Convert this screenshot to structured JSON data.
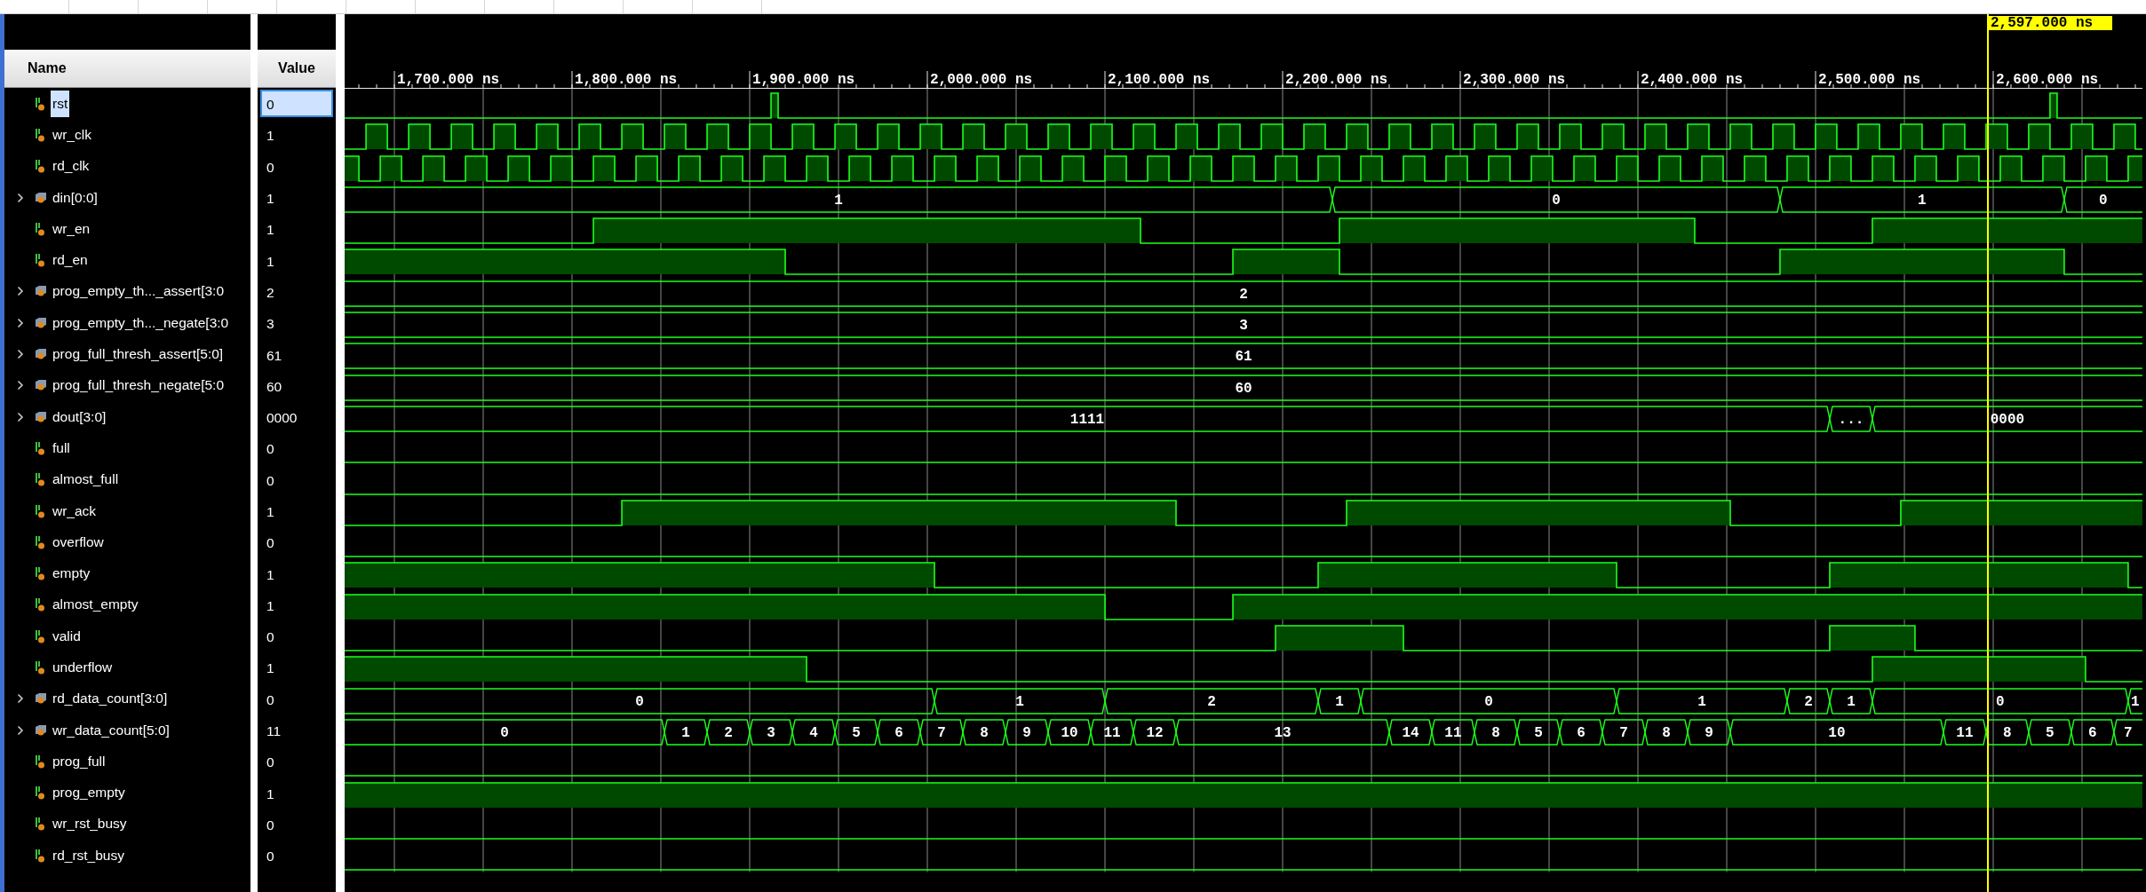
{
  "columns": {
    "name": "Name",
    "value": "Value"
  },
  "timeline": {
    "ticks": [
      "1,700.000 ns",
      "1,800.000 ns",
      "1,900.000 ns",
      "2,000.000 ns",
      "2,100.000 ns",
      "2,200.000 ns",
      "2,300.000 ns",
      "2,400.000 ns",
      "2,500.000 ns",
      "2,600.000 ns"
    ],
    "cursor": {
      "label": "2,597.000 ns",
      "level": 0.914
    }
  },
  "signals": [
    {
      "name": "rst",
      "value": "0",
      "kind": "bit",
      "selected": true
    },
    {
      "name": "wr_clk",
      "value": "1",
      "kind": "bit",
      "selected": false
    },
    {
      "name": "rd_clk",
      "value": "0",
      "kind": "bit",
      "selected": false
    },
    {
      "name": "din[0:0]",
      "value": "1",
      "kind": "bus",
      "selected": false,
      "data": [
        "1",
        "0",
        "1",
        "0"
      ]
    },
    {
      "name": "wr_en",
      "value": "1",
      "kind": "bit",
      "selected": false
    },
    {
      "name": "rd_en",
      "value": "1",
      "kind": "bit",
      "selected": false
    },
    {
      "name": "prog_empty_th..._assert[3:0",
      "value": "2",
      "kind": "bus",
      "selected": false,
      "data": [
        "2"
      ]
    },
    {
      "name": "prog_empty_th..._negate[3:0",
      "value": "3",
      "kind": "bus",
      "selected": false,
      "data": [
        "3"
      ]
    },
    {
      "name": "prog_full_thresh_assert[5:0]",
      "value": "61",
      "kind": "bus",
      "selected": false,
      "data": [
        "61"
      ]
    },
    {
      "name": "prog_full_thresh_negate[5:0",
      "value": "60",
      "kind": "bus",
      "selected": false,
      "data": [
        "60"
      ]
    },
    {
      "name": "dout[3:0]",
      "value": "0000",
      "kind": "bus",
      "selected": false,
      "data": [
        "1111",
        "...",
        "0000"
      ]
    },
    {
      "name": "full",
      "value": "0",
      "kind": "bit",
      "selected": false
    },
    {
      "name": "almost_full",
      "value": "0",
      "kind": "bit",
      "selected": false
    },
    {
      "name": "wr_ack",
      "value": "1",
      "kind": "bit",
      "selected": false
    },
    {
      "name": "overflow",
      "value": "0",
      "kind": "bit",
      "selected": false
    },
    {
      "name": "empty",
      "value": "1",
      "kind": "bit",
      "selected": false
    },
    {
      "name": "almost_empty",
      "value": "1",
      "kind": "bit",
      "selected": false
    },
    {
      "name": "valid",
      "value": "0",
      "kind": "bit",
      "selected": false
    },
    {
      "name": "underflow",
      "value": "1",
      "kind": "bit",
      "selected": false
    },
    {
      "name": "rd_data_count[3:0]",
      "value": "0",
      "kind": "bus",
      "selected": false,
      "data": [
        "0",
        "1",
        "2",
        "1",
        "0",
        "1",
        "2",
        "1",
        "0",
        "1"
      ]
    },
    {
      "name": "wr_data_count[5:0]",
      "value": "11",
      "kind": "bus",
      "selected": false,
      "data": [
        "0",
        "1",
        "2",
        "3",
        "4",
        "5",
        "6",
        "7",
        "8",
        "9",
        "10",
        "11",
        "12",
        "13",
        "14",
        "11",
        "8",
        "5",
        "6",
        "7",
        "8",
        "9",
        "10",
        "11",
        "8",
        "5",
        "6",
        "7"
      ]
    },
    {
      "name": "prog_full",
      "value": "0",
      "kind": "bit",
      "selected": false
    },
    {
      "name": "prog_empty",
      "value": "1",
      "kind": "bit",
      "selected": false
    },
    {
      "name": "wr_rst_busy",
      "value": "0",
      "kind": "bit",
      "selected": false
    },
    {
      "name": "rd_rst_busy",
      "value": "0",
      "kind": "bit",
      "selected": false
    }
  ]
}
